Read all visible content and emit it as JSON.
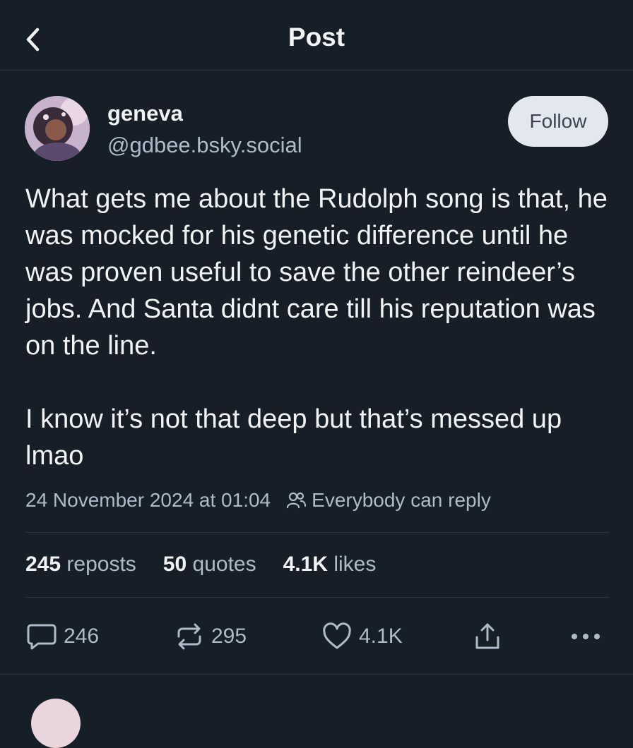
{
  "header": {
    "title": "Post"
  },
  "author": {
    "display_name": "geneva",
    "handle": "@gdbee.bsky.social",
    "follow_label": "Follow"
  },
  "post": {
    "paragraph1": "What gets me about the Rudolph song is that, he was mocked for his genetic difference until he was proven useful to save the other reindeer’s jobs. And Santa didnt care till his reputation was on the line.",
    "paragraph2": "I know it’s not that deep but that’s messed up lmao",
    "timestamp": "24 November 2024 at 01:04",
    "reply_setting": "Everybody can reply"
  },
  "stats": {
    "reposts_count": "245",
    "reposts_label": "reposts",
    "quotes_count": "50",
    "quotes_label": "quotes",
    "likes_count": "4.1K",
    "likes_label": "likes"
  },
  "actions": {
    "reply_count": "246",
    "repost_count": "295",
    "like_count": "4.1K",
    "icons": [
      "reply-icon",
      "repost-icon",
      "like-icon",
      "share-icon",
      "more-icon"
    ]
  },
  "colors": {
    "background": "#161e27",
    "text_primary": "#f1f3f5",
    "text_secondary": "#aebbc9",
    "divider": "#2b3540",
    "follow_bg": "#e3e8ee",
    "follow_text": "#394552"
  }
}
